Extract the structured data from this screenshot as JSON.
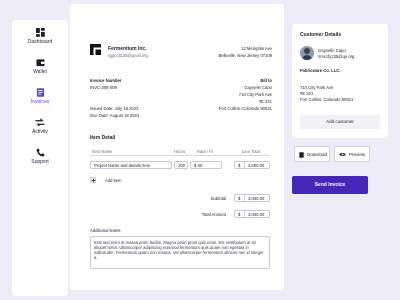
{
  "nav": {
    "items": [
      {
        "label": "Dashboard",
        "icon": "grid-icon"
      },
      {
        "label": "Wallet",
        "icon": "wallet-icon"
      },
      {
        "label": "Invoices",
        "icon": "invoice-icon"
      },
      {
        "label": "Activity",
        "icon": "activity-icon"
      },
      {
        "label": "Support",
        "icon": "phone-icon"
      }
    ]
  },
  "invoice": {
    "company": "Fermentium Inc.",
    "company_email": "sjjpccfj135@gnail.org",
    "company_address_line1": "12 Memphis Ave",
    "company_address_line2": "Belleville, New Jersey 07109",
    "number_label": "Invoice Number",
    "number": "INVC-306-009",
    "issued_date": "Issued Date: July 18 2023",
    "due_date": "Due Date: August 18 2023",
    "bill_to_label": "Bill to",
    "bill_to_name": "Gaynelle Capo",
    "bill_to_line1": "710 City Park Ave",
    "bill_to_line2": "#E 321",
    "bill_to_line3": "Fort Collins, Colorado 80521",
    "item_detail_label": "Item Detail",
    "columns": [
      "Item Name",
      "Hours",
      "Rate / hr",
      "Line Total"
    ],
    "row": {
      "name": "Project Name and details here",
      "hours": "100",
      "rate": "$ 30",
      "total": "3,000.00",
      "currency": "$"
    },
    "add_item": "Add item",
    "subtotal_label": "Subtotal",
    "subtotal_value": "3,000.00",
    "total_label": "Total Amount",
    "total_value": "3,000.00",
    "notes_label": "Additional Notes",
    "notes_text": "Erat sed enim et massa proin facilisi. Magna proin proin quis enim. Est vestibulum at sit aliquet tortor. Ullamcorper adipiscing euismod fermentum quis quam non egestas in sollicitudin. Fermentum quam non mauris. Vel ullamcorper fermentum ultrices nec id integer a."
  },
  "customer": {
    "title": "Customer Details",
    "name": "Gaynelle Capo",
    "email": "nmccfy135@qe.org",
    "company": "Fabricware Co. LLC.",
    "line1": "710 City Park Ave",
    "line2": "#E 321",
    "line3": "Fort Collins, Colorado 80521",
    "add_button": "Add customer"
  },
  "actions": {
    "download": "Download",
    "preview": "Preview",
    "send": "Send Invoice"
  },
  "colors": {
    "accent": "#5b46d6",
    "primary_button": "#4527b8",
    "background": "#edebf7"
  }
}
